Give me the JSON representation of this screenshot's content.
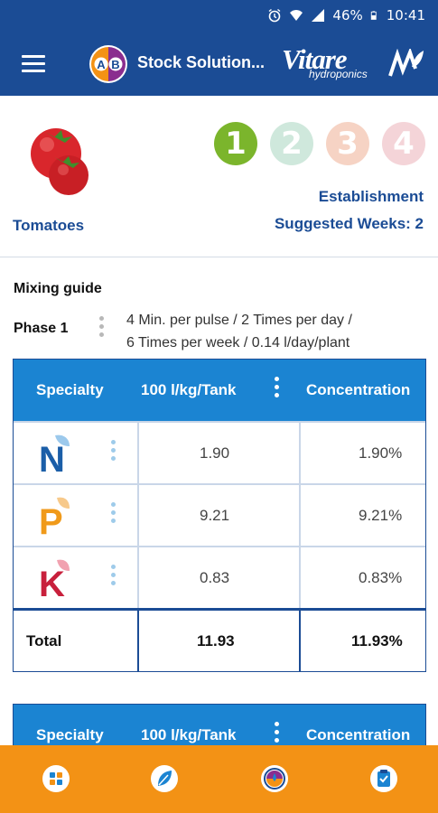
{
  "status_bar": {
    "battery": "46%",
    "time": "10:41",
    "icons": [
      "alarm-icon",
      "wifi-icon",
      "signal-icon",
      "battery-icon"
    ]
  },
  "app_bar": {
    "title": "Stock Solution...",
    "logo_letters": [
      "A",
      "B"
    ],
    "brand_name": "Vitare",
    "brand_sub": "hydroponics"
  },
  "crop": {
    "name": "Tomatoes",
    "stage": "Establishment",
    "suggested_weeks": "Suggested Weeks: 2",
    "phases": [
      {
        "number": "1",
        "active": true,
        "color": "#7bb52c"
      },
      {
        "number": "2",
        "active": false,
        "color": "#cfe8dc"
      },
      {
        "number": "3",
        "active": false,
        "color": "#f6d3c4"
      },
      {
        "number": "4",
        "active": false,
        "color": "#f4d4d8"
      }
    ]
  },
  "mixing_guide": {
    "title": "Mixing guide",
    "phase_label": "Phase 1",
    "description_line1": "4 Min. per pulse / 2 Times per day /",
    "description_line2": "6  Times per week / 0.14 l/day/plant"
  },
  "table": {
    "headers": [
      "Specialty",
      "100 l/kg/Tank",
      "Concentration"
    ],
    "rows": [
      {
        "nutrient": "N",
        "icon": "nitrogen-icon",
        "color": "#1b5ea8",
        "amount": "1.90",
        "concentration": "1.90%"
      },
      {
        "nutrient": "P",
        "icon": "phosphorus-icon",
        "color": "#f09a1a",
        "amount": "9.21",
        "concentration": "9.21%"
      },
      {
        "nutrient": "K",
        "icon": "potassium-icon",
        "color": "#c8203c",
        "amount": "0.83",
        "concentration": "0.83%"
      }
    ],
    "total": {
      "label": "Total",
      "amount": "11.93",
      "concentration": "11.93%"
    }
  },
  "table2": {
    "headers": [
      "Specialty",
      "100 l/kg/Tank",
      "Concentration"
    ]
  },
  "bottom_nav": {
    "items": [
      "grid-icon",
      "leaf-icon",
      "tank-icon",
      "checklist-icon"
    ],
    "background": "#f39215"
  },
  "colors": {
    "primary": "#1b4c95",
    "table_header": "#1b84d2",
    "accent": "#f39215"
  }
}
